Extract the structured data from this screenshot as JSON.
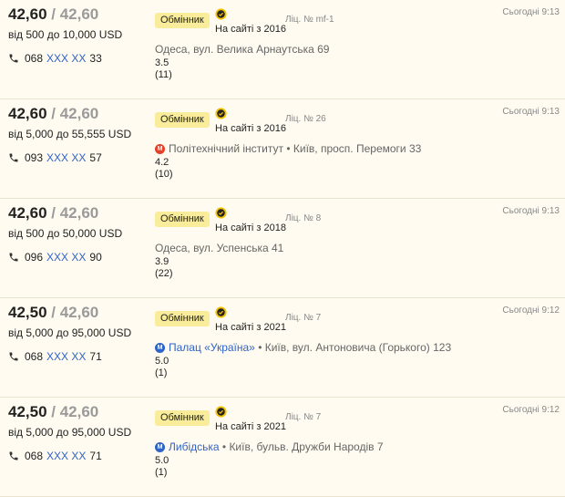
{
  "offers": [
    {
      "buy": "42,60",
      "sell": "42,60",
      "separator": " / ",
      "range": "від 500 до 10,000 USD",
      "phone_prefix": "068",
      "phone_hidden": "XXX XX",
      "phone_suffix": "33",
      "badge": "Обмінник",
      "since": "На сайті з 2016",
      "license": "Ліц. № mf-1",
      "time": "Сьогодні 9:13",
      "metro": null,
      "metro_separator": "",
      "address": "Одеса, вул. Велика Арнаутська 69",
      "rating": "3.5",
      "reviews": "(11)"
    },
    {
      "buy": "42,60",
      "sell": "42,60",
      "separator": " / ",
      "range": "від 5,000 до 55,555 USD",
      "phone_prefix": "093",
      "phone_hidden": "XXX XX",
      "phone_suffix": "57",
      "badge": "Обмінник",
      "since": "На сайті з 2016",
      "license": "Ліц. № 26",
      "time": "Сьогодні 9:13",
      "metro": "Політехнічний інститут",
      "metro_color": "#e2402b",
      "metro_separator": " • ",
      "address": "Київ, просп. Перемоги 33",
      "rating": "4.2",
      "reviews": "(10)"
    },
    {
      "buy": "42,60",
      "sell": "42,60",
      "separator": " / ",
      "range": "від 500 до 50,000 USD",
      "phone_prefix": "096",
      "phone_hidden": "XXX XX",
      "phone_suffix": "90",
      "badge": "Обмінник",
      "since": "На сайті з 2018",
      "license": "Ліц. № 8",
      "time": "Сьогодні 9:13",
      "metro": null,
      "metro_separator": "",
      "address": "Одеса, вул. Успенська 41",
      "rating": "3.9",
      "reviews": "(22)"
    },
    {
      "buy": "42,50",
      "sell": "42,60",
      "separator": " / ",
      "range": "від 5,000 до 95,000 USD",
      "phone_prefix": "068",
      "phone_hidden": "XXX XX",
      "phone_suffix": "71",
      "badge": "Обмінник",
      "since": "На сайті з 2021",
      "license": "Ліц. № 7",
      "time": "Сьогодні 9:12",
      "metro": "Палац «Україна»",
      "metro_color": "#2f63c8",
      "metro_separator": " • ",
      "address": "Київ, вул. Антоновича (Горького) 123",
      "rating": "5.0",
      "reviews": "(1)"
    },
    {
      "buy": "42,50",
      "sell": "42,60",
      "separator": " / ",
      "range": "від 5,000 до 95,000 USD",
      "phone_prefix": "068",
      "phone_hidden": "XXX XX",
      "phone_suffix": "71",
      "badge": "Обмінник",
      "since": "На сайті з 2021",
      "license": "Ліц. № 7",
      "time": "Сьогодні 9:12",
      "metro": "Либідська",
      "metro_color": "#2f63c8",
      "metro_separator": " • ",
      "address": "Київ, бульв. Дружби Народів 7",
      "rating": "5.0",
      "reviews": "(1)"
    }
  ],
  "icons": {
    "phone": "phone-icon",
    "verified": "verified-check-icon",
    "metro": "metro-icon"
  },
  "colors": {
    "background": "#fffbf0",
    "badge": "#f9ed9c",
    "link_blue": "#2f63c8",
    "metro_red": "#e2402b",
    "muted": "#888888"
  }
}
